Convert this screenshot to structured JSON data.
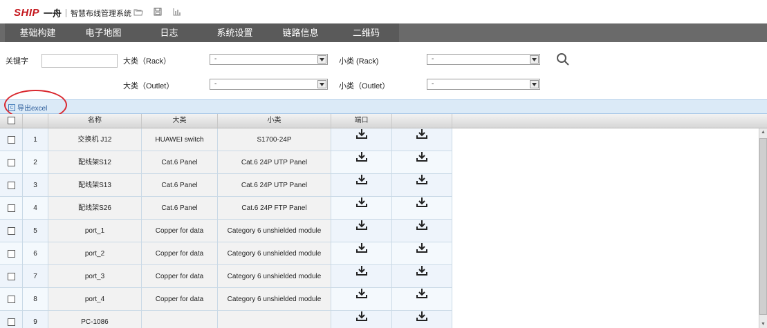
{
  "app": {
    "logo_ship": "SHIP",
    "logo_cn": "一舟",
    "system_name": "智慧布线管理系统",
    "icons": [
      "folder-icon",
      "save-icon",
      "bar-chart-icon"
    ]
  },
  "nav": {
    "items": [
      "基础构建",
      "电子地图",
      "日志",
      "系统设置",
      "链路信息",
      "二维码"
    ]
  },
  "filters": {
    "keyword_label": "关键字",
    "keyword_value": "",
    "rack_major_label": "大类（Rack）",
    "rack_major_value": "-",
    "rack_minor_label": "小类 (Rack)",
    "rack_minor_value": "-",
    "outlet_major_label": "大类（Outlet）",
    "outlet_major_value": "-",
    "outlet_minor_label": "小类（Outlet）",
    "outlet_minor_value": "-"
  },
  "toolbar": {
    "export_label": "导出excel"
  },
  "table": {
    "columns": [
      "",
      "",
      "名称",
      "大类",
      "小类",
      "端口",
      ""
    ],
    "rows": [
      {
        "num": "1",
        "name": "交换机 J12",
        "major": "HUAWEI switch",
        "minor": "S1700-24P"
      },
      {
        "num": "2",
        "name": "配线架S12",
        "major": "Cat.6 Panel",
        "minor": "Cat.6 24P UTP Panel"
      },
      {
        "num": "3",
        "name": "配线架S13",
        "major": "Cat.6 Panel",
        "minor": "Cat.6 24P UTP Panel"
      },
      {
        "num": "4",
        "name": "配线架S26",
        "major": "Cat.6 Panel",
        "minor": "Cat.6 24P FTP Panel"
      },
      {
        "num": "5",
        "name": "port_1",
        "major": "Copper for data",
        "minor": "Category 6 unshielded module"
      },
      {
        "num": "6",
        "name": "port_2",
        "major": "Copper for data",
        "minor": "Category 6 unshielded module"
      },
      {
        "num": "7",
        "name": "port_3",
        "major": "Copper for data",
        "minor": "Category 6 unshielded module"
      },
      {
        "num": "8",
        "name": "port_4",
        "major": "Copper for data",
        "minor": "Category 6 unshielded module"
      },
      {
        "num": "9",
        "name": "PC-1086",
        "major": "",
        "minor": ""
      }
    ]
  },
  "colors": {
    "brand_red": "#c4161c",
    "nav_bg": "#6a6a6a",
    "toolbar_bg": "#dbeaf7",
    "highlight_circle": "#d9272e"
  }
}
